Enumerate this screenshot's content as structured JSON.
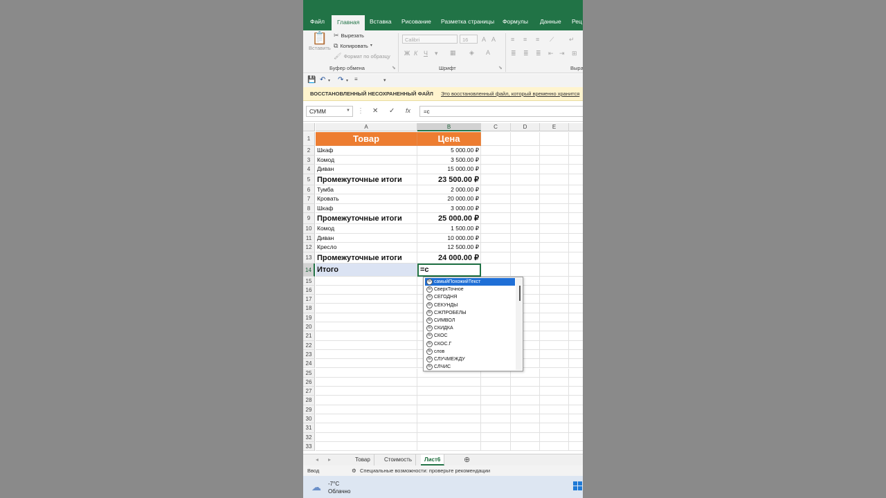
{
  "ribbon": {
    "tabs": [
      "Файл",
      "Главная",
      "Вставка",
      "Рисование",
      "Разметка страницы",
      "Формулы",
      "Данные",
      "Рец"
    ],
    "active_tab": "Главная",
    "paste_label": "Вставить",
    "cut_label": "Вырезать",
    "copy_label": "Копировать",
    "format_painter_label": "Формат по образцу",
    "clipboard_group": "Буфер обмена",
    "font_group": "Шрифт",
    "align_group": "Выра",
    "font_name": "Calibri",
    "font_size": "16",
    "bold": "Ж",
    "italic": "К",
    "underline": "Ч"
  },
  "notice": {
    "title": "ВОССТАНОВЛЕННЫЙ НЕСОХРАНЕННЫЙ ФАЙЛ",
    "text": "Это восстановленный файл, который временно хранится"
  },
  "formula_bar": {
    "name_box": "СУММ",
    "content": "=с"
  },
  "grid": {
    "columns": [
      "A",
      "B",
      "C",
      "D",
      "E"
    ],
    "header_row": {
      "a": "Товар",
      "b": "Цена"
    },
    "rows": [
      {
        "num": "2",
        "a": "Шкаф",
        "b": "5 000.00 ₽",
        "type": "normal"
      },
      {
        "num": "3",
        "a": "Комод",
        "b": "3 500.00 ₽",
        "type": "normal"
      },
      {
        "num": "4",
        "a": "Диван",
        "b": "15 000.00 ₽",
        "type": "normal"
      },
      {
        "num": "5",
        "a": "Промежуточные итоги",
        "b": "23 500.00 ₽",
        "type": "bold"
      },
      {
        "num": "6",
        "a": "Тумба",
        "b": "2 000.00 ₽",
        "type": "normal"
      },
      {
        "num": "7",
        "a": "Кровать",
        "b": "20 000.00 ₽",
        "type": "normal"
      },
      {
        "num": "8",
        "a": "Шкаф",
        "b": "3 000.00 ₽",
        "type": "normal"
      },
      {
        "num": "9",
        "a": "Промежуточные итоги",
        "b": "25 000.00 ₽",
        "type": "bold"
      },
      {
        "num": "10",
        "a": "Комод",
        "b": "1 500.00 ₽",
        "type": "normal"
      },
      {
        "num": "11",
        "a": "Диван",
        "b": "10 000.00 ₽",
        "type": "normal"
      },
      {
        "num": "12",
        "a": "Кресло",
        "b": "12 500.00 ₽",
        "type": "normal"
      },
      {
        "num": "13",
        "a": "Промежуточные итоги",
        "b": "24 000.00 ₽",
        "type": "bold"
      },
      {
        "num": "14",
        "a": "Итого",
        "b": "=с",
        "type": "total"
      }
    ],
    "empty_rows": [
      "15",
      "16",
      "17",
      "18",
      "19",
      "20",
      "21",
      "22",
      "23",
      "24",
      "25",
      "26",
      "27",
      "28",
      "29",
      "30",
      "31",
      "32",
      "33"
    ]
  },
  "autocomplete": {
    "items": [
      "самыйПохожийТекст",
      "СверхТочное",
      "СЕГОДНЯ",
      "СЕКУНДЫ",
      "СЖПРОБЕЛЫ",
      "СИМВОЛ",
      "СКИДКА",
      "СКОС",
      "СКОС.Г",
      "слов",
      "СЛУЧМЕЖДУ",
      "СЛЧИС"
    ],
    "selected_index": 0
  },
  "sheets": {
    "tabs": [
      "Товар",
      "Стоимость",
      "Лист6"
    ],
    "active": "Лист6"
  },
  "status": {
    "mode": "Ввод",
    "accessibility": "Специальные возможности: проверьте рекомендации"
  },
  "taskbar": {
    "temperature": "-7°C",
    "weather": "Облачно"
  },
  "colors": {
    "excel_green": "#217346",
    "header_orange": "#ed7d31",
    "total_fill": "#dbe3f3"
  }
}
